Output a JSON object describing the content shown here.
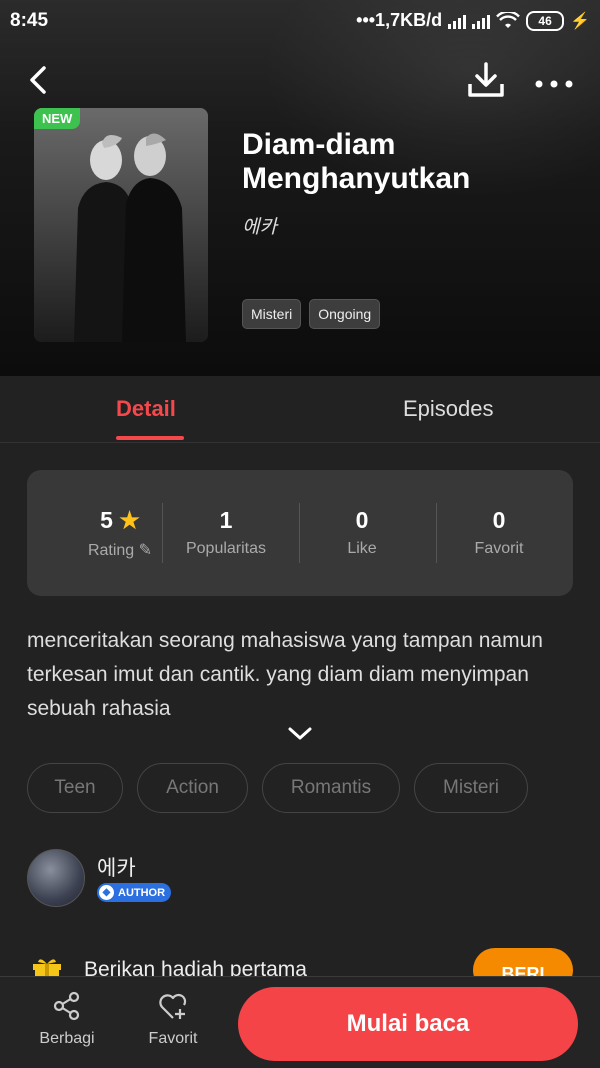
{
  "status_bar": {
    "time": "8:45",
    "network": "•••1,7KB/d",
    "battery": "46"
  },
  "comic": {
    "badge": "NEW",
    "title_line1": "Diam-diam",
    "title_line2": "Menghanyutkan",
    "author": "에카",
    "tags": [
      "Misteri",
      "Ongoing"
    ]
  },
  "tabs": {
    "detail": "Detail",
    "episodes": "Episodes"
  },
  "stats": {
    "rating": {
      "value": "5",
      "label": "Rating"
    },
    "popularity": {
      "value": "1",
      "label": "Popularitas"
    },
    "like": {
      "value": "0",
      "label": "Like"
    },
    "favorite": {
      "value": "0",
      "label": "Favorit"
    }
  },
  "description": "menceritakan seorang mahasiswa yang tampan namun terkesan imut dan cantik. yang diam diam menyimpan sebuah rahasia",
  "genres": [
    "Teen",
    "Action",
    "Romantis",
    "Misteri"
  ],
  "author_section": {
    "name": "에카",
    "badge": "AUTHOR"
  },
  "gift": {
    "text": "Berikan hadiah pertama",
    "button": "BERI"
  },
  "bottom_bar": {
    "share": "Berbagi",
    "favorite": "Favorit",
    "start_reading": "Mulai baca"
  },
  "colors": {
    "accent": "#f4484b",
    "orange": "#f58a00",
    "new_badge": "#3ec24f",
    "author_badge": "#2b6fe0"
  }
}
